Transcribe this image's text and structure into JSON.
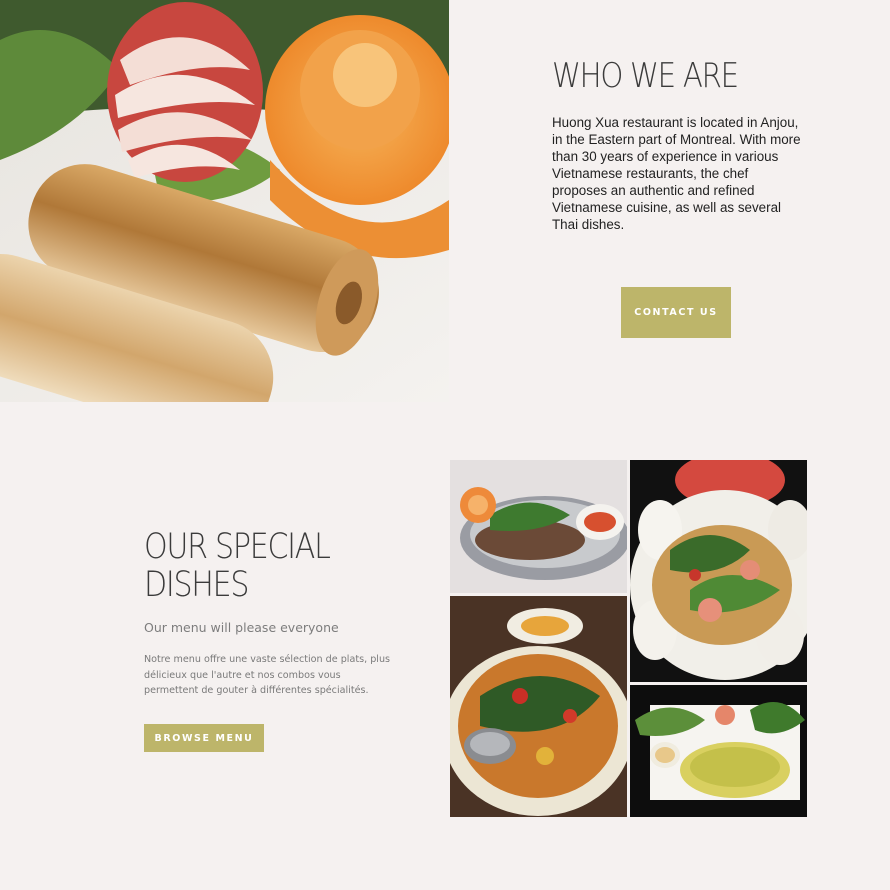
{
  "about": {
    "title": "WHO WE ARE",
    "text": "Huong Xua restaurant is located in Anjou, in the Eastern part of Montreal. With more than 30 years of experience in various Vietnamese restaurants, the chef proposes an authentic and refined Vietnamese cuisine, as well as several Thai dishes.",
    "button_label": "CONTACT US"
  },
  "special": {
    "title": "OUR SPECIAL DISHES",
    "subtitle": "Our menu will please everyone",
    "description": "Notre menu offre une vaste sélection de plats, plus délicieux que l'autre et nos combos vous permettent de gouter à différentes spécialités.",
    "button_label": "BROWSE MENU"
  },
  "colors": {
    "background": "#f5f1f0",
    "accent": "#bdb56a",
    "heading": "#3b3b3b"
  }
}
